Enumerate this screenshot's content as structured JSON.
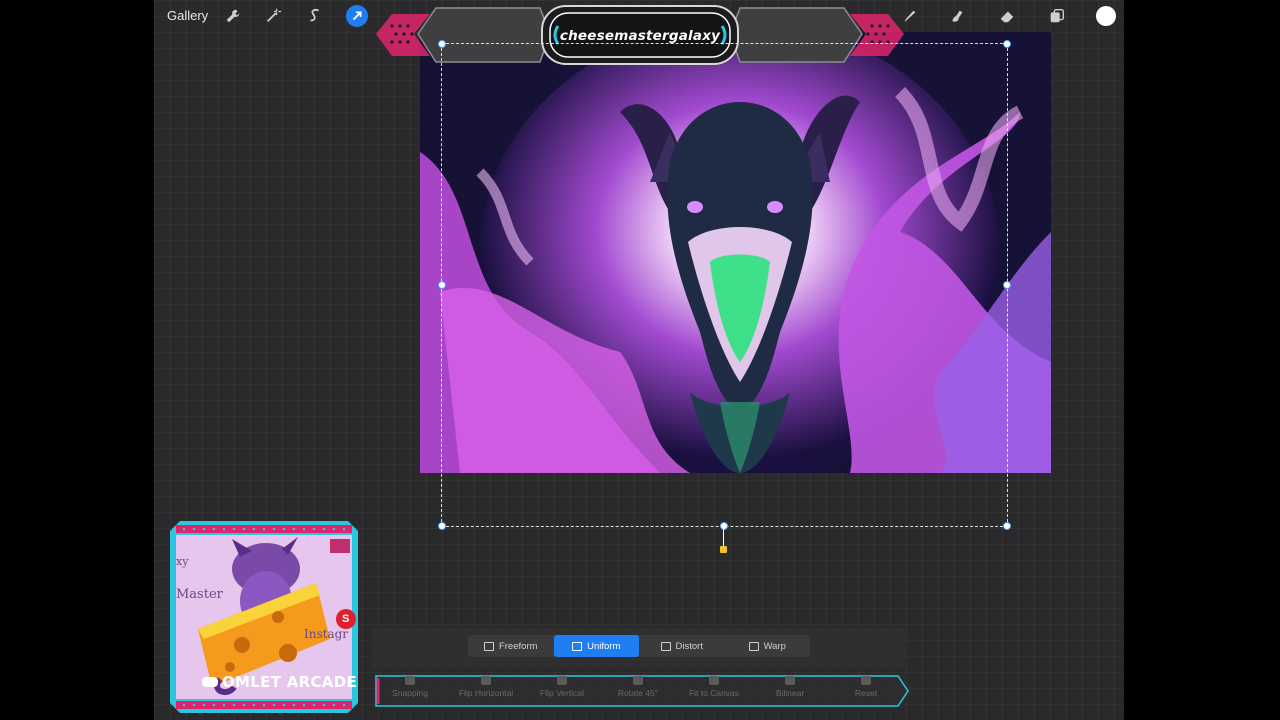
{
  "toolbar": {
    "gallery_label": "Gallery",
    "left_icons": [
      "wrench-icon",
      "magic-wand-icon",
      "selection-s-icon",
      "transform-arrow-icon"
    ],
    "right_icons": [
      "brush-icon",
      "smudge-icon",
      "eraser-icon",
      "layers-icon",
      "color-swatch-icon"
    ],
    "active_tool": "transform-arrow-icon",
    "current_color": "#ffffff",
    "accent_color": "#1f7ef2"
  },
  "overlay": {
    "username": "cheesemastergalaxy",
    "accent_cyan": "#28c8e0",
    "accent_pink": "#e0246c"
  },
  "transform_modes": {
    "items": [
      "Freeform",
      "Uniform",
      "Distort",
      "Warp"
    ],
    "selected": "Uniform"
  },
  "actions": {
    "items": [
      "Snapping",
      "Flip Horizontal",
      "Flip Vertical",
      "Rotate 45°",
      "Fit to Canvas",
      "Bilinear",
      "Reset"
    ]
  },
  "webcam": {
    "brand_text": "OMLET ARCADE",
    "sign_text_1": "xy",
    "sign_text_2": "Master",
    "sign_text_3": "Instagr",
    "sign_text_4": "S"
  }
}
